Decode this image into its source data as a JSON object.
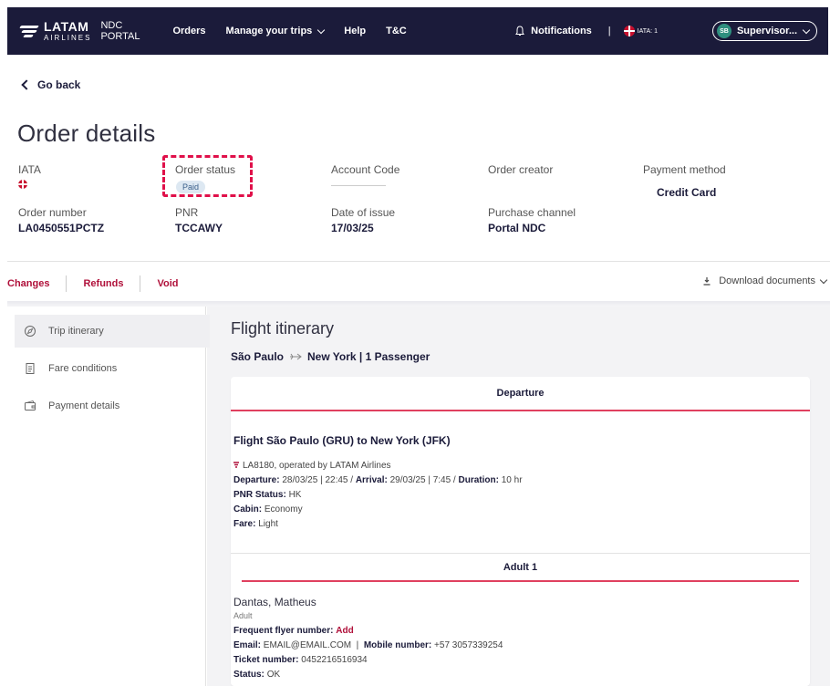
{
  "header": {
    "brand": "LATAM",
    "brand_sub": "AIRLINES",
    "portal_line1": "NDC",
    "portal_line2": "PORTAL",
    "nav": [
      "Orders",
      "Manage your trips",
      "Help",
      "T&C"
    ],
    "notifications": "Notifications",
    "separator": "|",
    "iata_label": "IATA: 1",
    "user_initials": "SB",
    "user_label": "Supervisor..."
  },
  "go_back": "Go back",
  "page_title": "Order details",
  "order": {
    "iata_label": "IATA",
    "status_label": "Order status",
    "status_value": "Paid",
    "account_code_label": "Account Code",
    "creator_label": "Order creator",
    "payment_label": "Payment method",
    "payment_value": "Credit Card",
    "number_label": "Order number",
    "number_value": "LA0450551PCTZ",
    "pnr_label": "PNR",
    "pnr_value": "TCCAWY",
    "issue_label": "Date of issue",
    "issue_value": "17/03/25",
    "channel_label": "Purchase channel",
    "channel_value": "Portal NDC"
  },
  "actions": [
    "Changes",
    "Refunds",
    "Void"
  ],
  "download": "Download documents",
  "sidebar": [
    "Trip itinerary",
    "Fare conditions",
    "Payment details"
  ],
  "itinerary": {
    "title": "Flight itinerary",
    "origin": "São Paulo",
    "route_rest": "New York | 1 Passenger",
    "departure_tab": "Departure",
    "flight_title": "Flight São Paulo (GRU) to New York (JFK)",
    "operated": "LA8180, operated by LATAM Airlines",
    "departure_label": "Departure:",
    "departure_value": "28/03/25 | 22:45 /",
    "arrival_label": "Arrival:",
    "arrival_value": "29/03/25 | 7:45 /",
    "duration_label": "Duration:",
    "duration_value": "10 hr",
    "pnr_status_label": "PNR Status:",
    "pnr_status_value": "HK",
    "cabin_label": "Cabin:",
    "cabin_value": "Economy",
    "fare_label": "Fare:",
    "fare_value": "Light"
  },
  "passenger": {
    "tab": "Adult 1",
    "name": "Dantas, Matheus",
    "type": "Adult",
    "ffn_label": "Frequent flyer number:",
    "ffn_add": "Add",
    "email_label": "Email:",
    "email_value": "EMAIL@EMAIL.COM",
    "pipe": "|",
    "mobile_label": "Mobile number:",
    "mobile_value": "+57 3057339254",
    "ticket_label": "Ticket number:",
    "ticket_value": "0452216516934",
    "status_label": "Status:",
    "status_value": "OK"
  },
  "colors": {
    "navy": "#1b1b3a",
    "accent": "#b0103a",
    "highlight": "#e0104a"
  }
}
